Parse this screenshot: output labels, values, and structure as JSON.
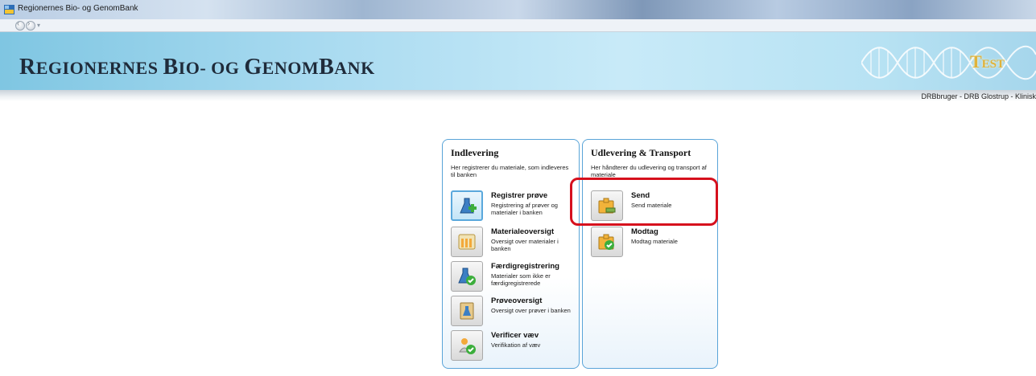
{
  "window": {
    "title": "Regionernes Bio- og GenomBank"
  },
  "banner": {
    "brand_first": "R",
    "brand_rest": "EGIONERNES ",
    "brand_b": "B",
    "brand_mid": "IO- OG ",
    "brand_g": "G",
    "brand_end": "ENOM",
    "brand_b2": "B",
    "brand_tail": "ANK",
    "environment": "Test"
  },
  "user": {
    "info": "DRBbruger - DRB Glostrup - Klinisk"
  },
  "indlevering": {
    "title": "Indlevering",
    "description": "Her registrerer du materiale, som indleveres til banken",
    "items": [
      {
        "label": "Registrer prøve",
        "sub": "Registrering af prøver og materialer i banken",
        "icon": "flask-add-icon"
      },
      {
        "label": "Materialeoversigt",
        "sub": "Oversigt over materialer i banken",
        "icon": "rack-icon"
      },
      {
        "label": "Færdigregistrering",
        "sub": "Materialer som ikke er færdigregistrerede",
        "icon": "flask-check-icon"
      },
      {
        "label": "Prøveoversigt",
        "sub": "Oversigt over prøver i banken",
        "icon": "binder-icon"
      },
      {
        "label": "Verificer væv",
        "sub": "Verifikation af væv",
        "icon": "tissue-check-icon"
      }
    ]
  },
  "udlevering": {
    "title": "Udlevering & Transport",
    "description": "Her håndterer du udlevering og transport af materiale",
    "items": [
      {
        "label": "Send",
        "sub": "Send materiale",
        "icon": "package-send-icon"
      },
      {
        "label": "Modtag",
        "sub": "Modtag materiale",
        "icon": "package-receive-icon"
      }
    ]
  },
  "colors": {
    "panel_border": "#59a4d8",
    "highlight": "#d6101d",
    "banner": "#a8daf0"
  }
}
